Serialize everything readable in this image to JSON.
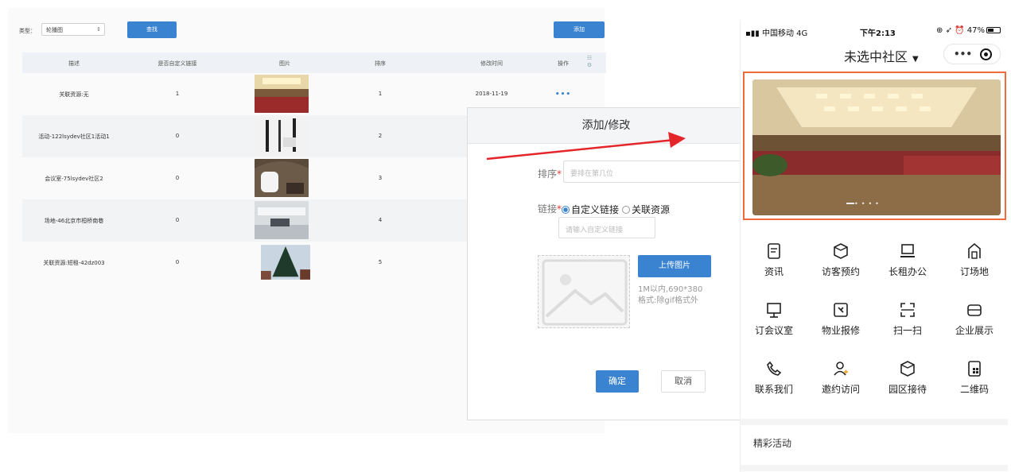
{
  "admin": {
    "filter_label": "类型：",
    "filter_value": "轮播图",
    "search_button": "查找",
    "add_button": "添加",
    "columns": [
      "描述",
      "是否自定义链接",
      "图片",
      "排序",
      "修改时间",
      "操作"
    ],
    "rows": [
      {
        "desc": "关联资源:无",
        "custom": "1",
        "order": "1",
        "time": "2018-11-19",
        "action": "•••"
      },
      {
        "desc": "活动-122lsydev社区1活动1",
        "custom": "0",
        "order": "2",
        "time": "",
        "action": ""
      },
      {
        "desc": "会议室-75lsydev社区2",
        "custom": "0",
        "order": "3",
        "time": "",
        "action": ""
      },
      {
        "desc": "场地-46北京市桓桥南巷",
        "custom": "0",
        "order": "4",
        "time": "",
        "action": ""
      },
      {
        "desc": "关联资源:短租-42dz003",
        "custom": "0",
        "order": "5",
        "time": "",
        "action": ""
      }
    ]
  },
  "modal": {
    "title": "添加/修改",
    "order_label": "排序",
    "order_placeholder": "要排在第几位",
    "link_label": "链接",
    "link_option_custom": "自定义链接",
    "link_option_resource": "关联资源",
    "link_placeholder": "请输入自定义链接",
    "upload_button": "上传图片",
    "upload_note_1": "1M以内,690*380",
    "upload_note_2": "格式:除gif格式外",
    "ok_button": "确定",
    "cancel_button": "取消"
  },
  "phone": {
    "carrier": "中国移动 4G",
    "time": "下午2:13",
    "battery": "47%",
    "nav_title": "未选中社区",
    "menu_items": [
      "资讯",
      "访客预约",
      "长租办公",
      "订场地",
      "订会议室",
      "物业报修",
      "扫一扫",
      "企业展示",
      "联系我们",
      "邀约访问",
      "园区接待",
      "二维码"
    ],
    "section_title": "精彩活动"
  },
  "colors": {
    "accent": "#3a83d0",
    "highlight": "#f06b3c",
    "arrow": "#e4262b"
  }
}
